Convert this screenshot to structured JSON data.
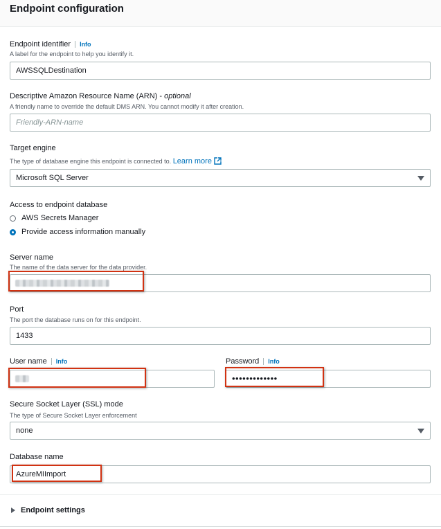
{
  "section": {
    "title": "Endpoint configuration"
  },
  "info_label": "Info",
  "endpoint_identifier": {
    "label": "Endpoint identifier",
    "description": "A label for the endpoint to help you identify it.",
    "value": "AWSSQLDestination"
  },
  "arn": {
    "label": "Descriptive Amazon Resource Name (ARN) - ",
    "optional": "optional",
    "description": "A friendly name to override the default DMS ARN. You cannot modify it after creation.",
    "placeholder": "Friendly-ARN-name"
  },
  "target_engine": {
    "label": "Target engine",
    "description": "The type of database engine this endpoint is connected to.",
    "learn_more": "Learn more",
    "value": "Microsoft SQL Server"
  },
  "access": {
    "label": "Access to endpoint database",
    "options": [
      {
        "label": "AWS Secrets Manager",
        "checked": false
      },
      {
        "label": "Provide access information manually",
        "checked": true
      }
    ]
  },
  "server_name": {
    "label": "Server name",
    "description": "The name of the data server for the data provider."
  },
  "port": {
    "label": "Port",
    "description": "The port the database runs on for this endpoint.",
    "value": "1433"
  },
  "user_name": {
    "label": "User name"
  },
  "password": {
    "label": "Password",
    "value": "•••••••••••••"
  },
  "ssl": {
    "label": "Secure Socket Layer (SSL) mode",
    "description": "The type of Secure Socket Layer enforcement",
    "value": "none"
  },
  "database_name": {
    "label": "Database name",
    "value": "AzureMIImport"
  },
  "endpoint_settings": {
    "label": "Endpoint settings"
  },
  "colors": {
    "accent": "#0073bb",
    "highlight": "#d13212",
    "border": "#aab7b8"
  }
}
